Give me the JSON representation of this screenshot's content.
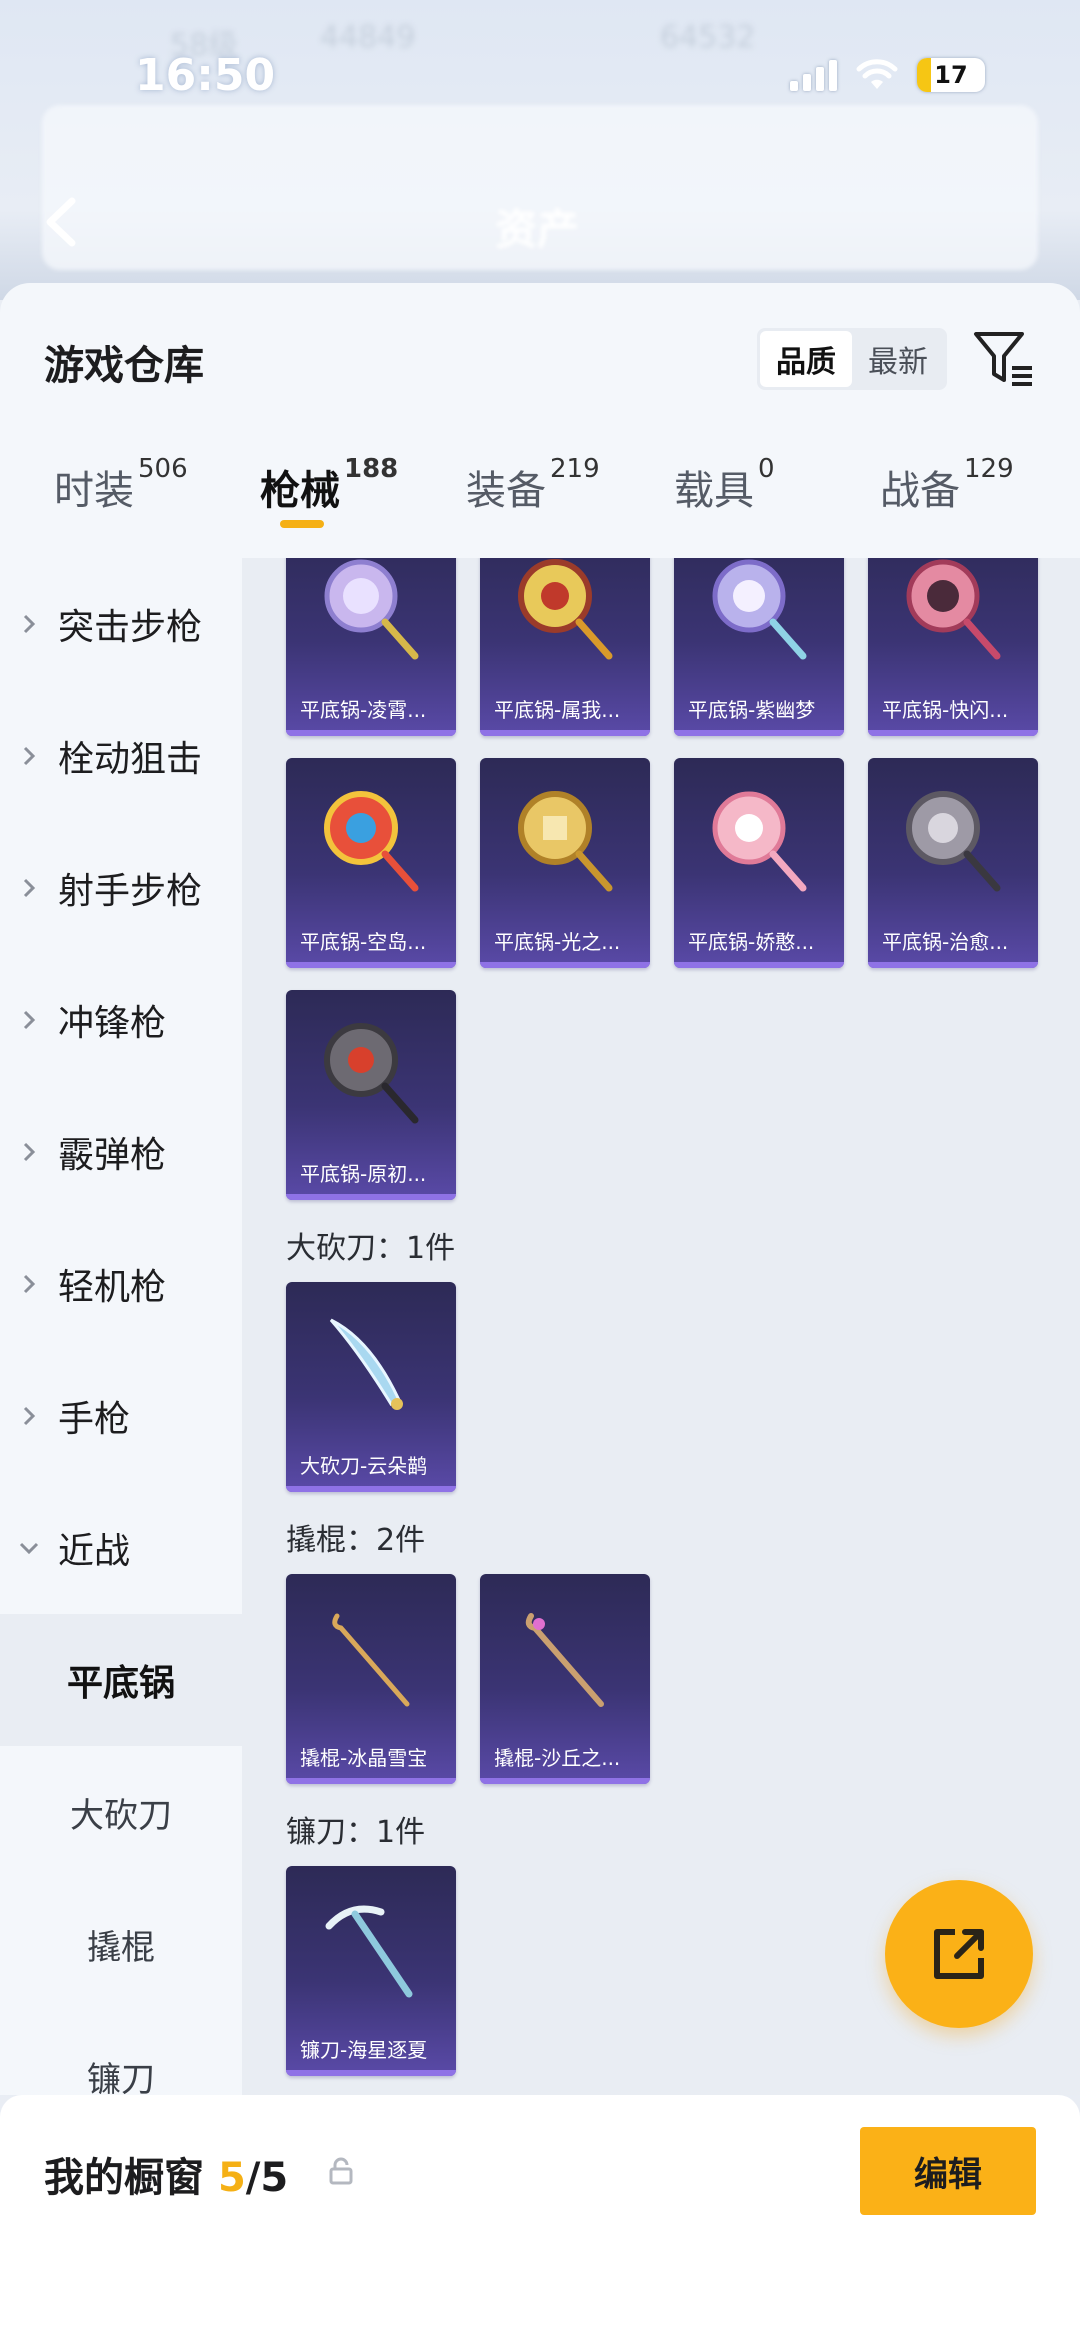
{
  "status_bar": {
    "time": "16:50",
    "battery": "17"
  },
  "background": {
    "title": "资产",
    "level": "58级",
    "stat1": "44849",
    "stat2": "64532"
  },
  "sheet": {
    "title": "游戏仓库",
    "sort": {
      "options": [
        "品质",
        "最新"
      ],
      "active": "品质"
    }
  },
  "tabs": [
    {
      "label": "时装",
      "count": "506"
    },
    {
      "label": "枪械",
      "count": "188"
    },
    {
      "label": "装备",
      "count": "219"
    },
    {
      "label": "载具",
      "count": "0"
    },
    {
      "label": "战备",
      "count": "129"
    }
  ],
  "left_nav": {
    "categories": [
      "突击步枪",
      "栓动狙击",
      "射手步枪",
      "冲锋枪",
      "霰弹枪",
      "轻机枪",
      "手枪",
      "近战"
    ],
    "subs": [
      "平底锅",
      "大砍刀",
      "撬棍",
      "镰刀"
    ],
    "active_sub": "平底锅"
  },
  "items": {
    "pans": [
      "平底锅-凌霄...",
      "平底锅-属我...",
      "平底锅-紫幽梦",
      "平底锅-快闪...",
      "平底锅-空岛...",
      "平底锅-光之...",
      "平底锅-娇憨...",
      "平底锅-治愈...",
      "平底锅-原初..."
    ],
    "machete_title": "大砍刀：1件",
    "machetes": [
      "大砍刀-云朵鹋"
    ],
    "crowbar_title": "撬棍：2件",
    "crowbars": [
      "撬棍-冰晶雪宝",
      "撬棍-沙丘之..."
    ],
    "sickle_title": "镰刀：1件",
    "sickles": [
      "镰刀-海星逐夏"
    ]
  },
  "bottom": {
    "title_prefix": "我的橱窗 ",
    "count_current": "5",
    "count_sep_total": "/5",
    "edit_label": "编辑"
  },
  "colors": {
    "accent": "#fbb117",
    "card_dark": "#2d2a56",
    "card_light": "#5a4aa8"
  }
}
